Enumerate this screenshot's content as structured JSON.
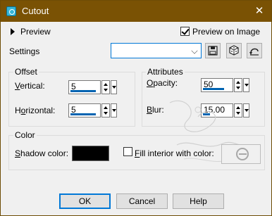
{
  "window": {
    "title": "Cutout",
    "close_glyph": "✕"
  },
  "preview": {
    "label": "Preview",
    "preview_on_image_label": "Preview on Image",
    "preview_on_image_checked": true
  },
  "settings": {
    "label": "Settings",
    "combo_value": ""
  },
  "offset": {
    "group_label": "Offset",
    "vertical_label": "Vertical:",
    "vertical_value": "5",
    "horizontal_label": "Horizontal:",
    "horizontal_value": "5"
  },
  "attributes": {
    "group_label": "Attributes",
    "opacity_label": "Opacity:",
    "opacity_value": "50",
    "blur_label": "Blur:",
    "blur_value": "15.00"
  },
  "color": {
    "group_label": "Color",
    "shadow_color_label": "Shadow color:",
    "shadow_color": "#000000",
    "fill_interior_label": "Fill interior with color:",
    "fill_interior_checked": false
  },
  "buttons": {
    "ok": "OK",
    "cancel": "Cancel",
    "help": "Help"
  },
  "icons": {
    "app": "cutout-icon",
    "save": "save-preset-icon",
    "randomize": "dice-icon",
    "reset": "reset-icon",
    "no_color": "no-color-icon"
  },
  "colors": {
    "titlebar": "#7a5204",
    "accent": "#0078d7"
  }
}
